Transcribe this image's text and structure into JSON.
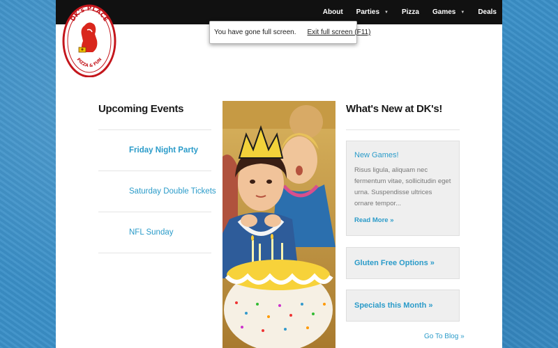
{
  "nav": {
    "items": [
      {
        "label": "About",
        "has_dropdown": false
      },
      {
        "label": "Parties",
        "has_dropdown": true
      },
      {
        "label": "Pizza",
        "has_dropdown": false
      },
      {
        "label": "Games",
        "has_dropdown": true
      },
      {
        "label": "Deals",
        "has_dropdown": false
      }
    ],
    "dropdown_icon": "caret-down"
  },
  "logo": {
    "top_text": "DK's PLACE",
    "bottom_text": "PIZZA & FUN",
    "colors": {
      "ring": "#c4161c",
      "figure": "#d9261c",
      "accent": "#f2c200"
    }
  },
  "fullscreen_notice": {
    "message": "You have gone full screen.",
    "exit_label": "Exit full screen (F11)"
  },
  "events": {
    "title": "Upcoming Events",
    "items": [
      {
        "label": "Friday Night Party"
      },
      {
        "label": "Saturday Double Tickets"
      },
      {
        "label": "NFL Sunday"
      }
    ]
  },
  "news": {
    "title": "What's New at DK's!",
    "featured": {
      "title": "New Games!",
      "text": "Risus ligula, aliquam nec fermentum vitae, sollicitudin eget urna. Suspendisse ultrices ornare tempor...",
      "read_more": "Read More »"
    },
    "links": [
      {
        "label": "Gluten Free Options »"
      },
      {
        "label": "Specials this Month »"
      }
    ],
    "blog_link": "Go To Blog »"
  },
  "colors": {
    "link": "#2a9bc9",
    "topbar": "#111111",
    "background": "#3a8fc7",
    "card": "#efefef"
  }
}
